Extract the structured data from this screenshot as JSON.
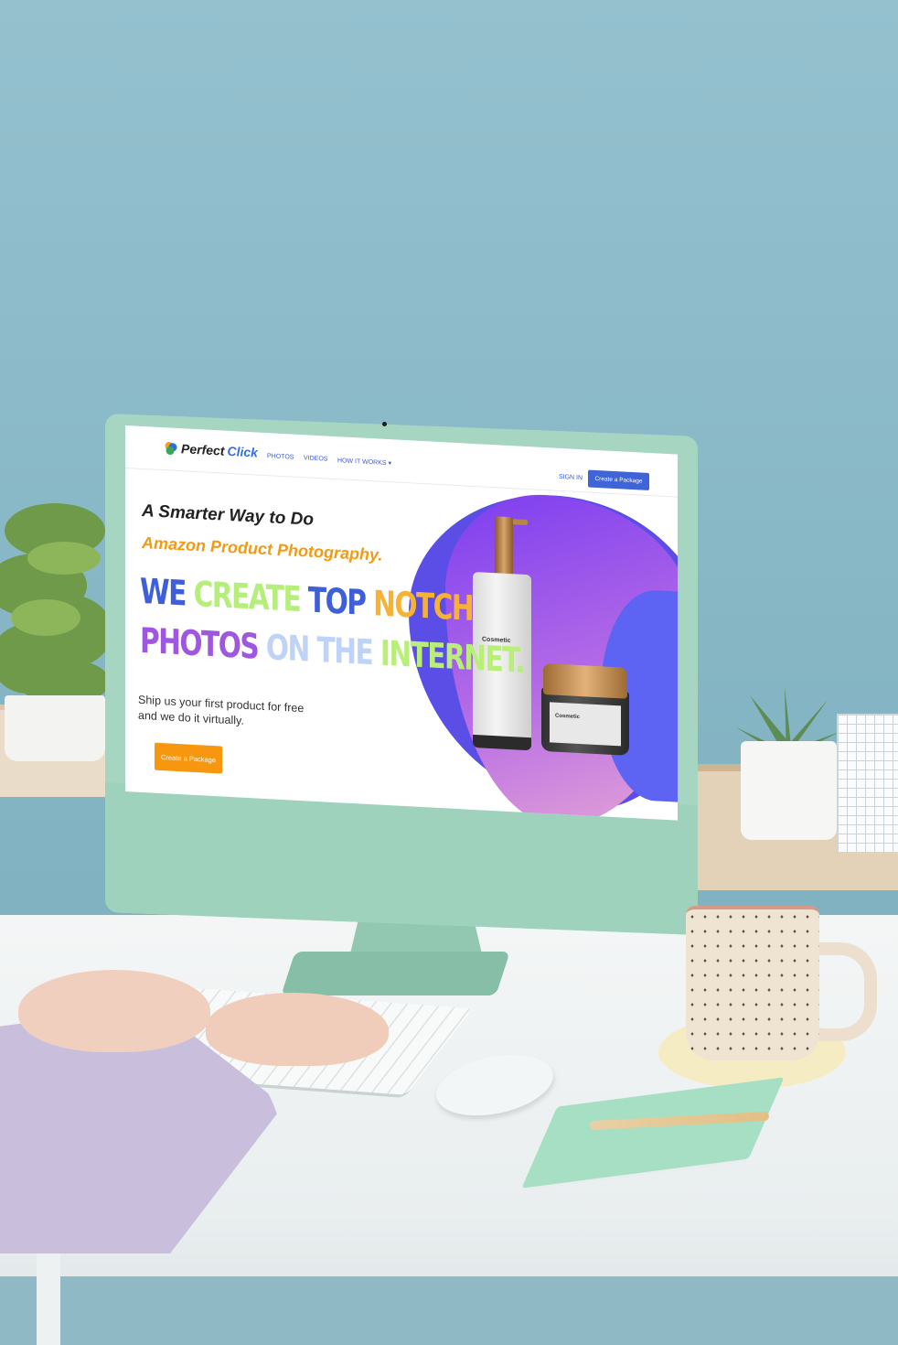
{
  "screen": {
    "logo": {
      "word1": "Perfect",
      "word2": "Click"
    },
    "nav": {
      "photos": "PHOTOS",
      "videos": "VIDEOS",
      "how": "HOW IT WORKS ▾",
      "signin": "SIGN IN",
      "cta": "Create a Package"
    },
    "hero": {
      "line1": "A Smarter Way to Do",
      "line2": "Amazon Product Photography.",
      "big1": [
        {
          "text": "WE",
          "color": "#3f5fd8"
        },
        {
          "text": "CREATE",
          "color": "#b5ee7a"
        },
        {
          "text": "TOP",
          "color": "#3f5fd8"
        },
        {
          "text": "NOTCH",
          "color": "#f7b233"
        }
      ],
      "big2": [
        {
          "text": "PHOTOS",
          "color": "#a057e0"
        },
        {
          "text": "ON THE",
          "color": "#bfd3f7"
        },
        {
          "text": "INTERNET.",
          "color": "#b9ef79"
        }
      ],
      "sub1": "Ship us your first product for free",
      "sub2": "and we do it virtually.",
      "cta": "Create a Package"
    },
    "products": {
      "bottle_label": "Cosmetic",
      "jar_label": "Cosmetic"
    }
  },
  "colors": {
    "accent_blue": "#3f64d8",
    "accent_orange": "#f7960f",
    "monitor": "#a6d6c2",
    "wall": "#8fbccb"
  }
}
